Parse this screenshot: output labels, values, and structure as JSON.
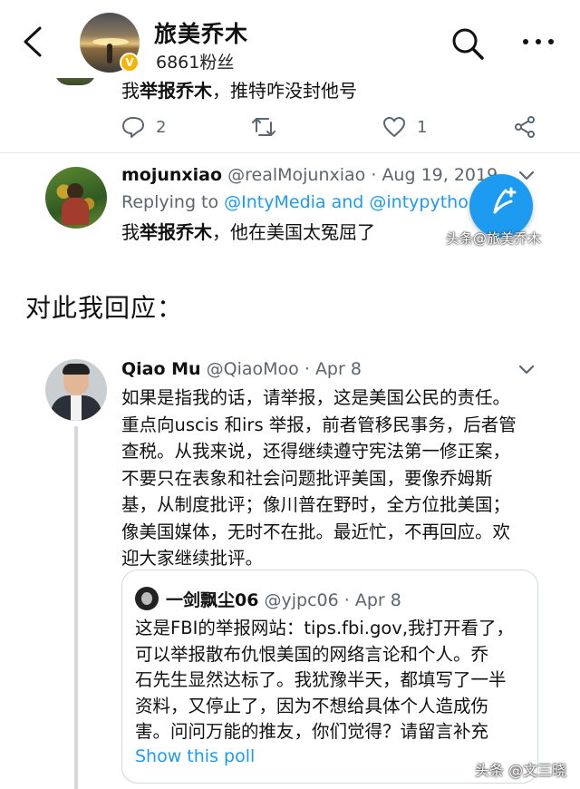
{
  "topbar": {
    "title": "旅美乔木",
    "fans": "6861粉丝"
  },
  "tweet1": {
    "text_pre": "我",
    "text_bold": "举报乔木",
    "text_post": "，推特咋没封他号",
    "reply_count": "2",
    "like_count": "1"
  },
  "tweet2": {
    "name": "mojunxiao",
    "handle": "@realMojunxiao",
    "date": "Aug 19, 2019",
    "replying_prefix": "Replying to ",
    "replying_targets": "@IntyMedia and @intypython",
    "text_pre": "我",
    "text_bold": "举报乔木",
    "text_post": "，他在美国太冤屈了"
  },
  "watermarks": {
    "fab": "头条@旅美乔木",
    "bottom": "头条 @文三晓"
  },
  "intro": "对此我回应：",
  "tweet3": {
    "name": "Qiao Mu",
    "handle": "@QiaoMoo",
    "date": "Apr 8",
    "lines": [
      "如果是指我的话，请举报，这是美国公民的责任。",
      "重点向uscis 和irs 举报，前者管移民事务，后者管",
      "查税。从我来说，还得继续遵守宪法第一修正案，",
      "不要只在表象和社会问题批评美国，要像乔姆斯",
      "基，从制度批评；像川普在野时，全方位批美国；",
      "像美国媒体，无时不在批。最近忙，不再回应。欢",
      "迎大家继续批评。"
    ]
  },
  "quote": {
    "name": "一剑飘尘06",
    "handle": "@yjpc06",
    "date": "Apr 8",
    "lines": [
      "这是FBI的举报网站：tips.fbi.gov,我打开看了，",
      "可以举报散布仇恨美国的网络言论和个人。乔",
      "石先生显然达标了。我犹豫半天，都填写了一半",
      "资料，又停止了，因为不想给具体个人造成伤",
      "害。问问万能的推友，你们觉得？请留言补充"
    ],
    "poll_link": "Show this poll"
  },
  "colors": {
    "accent": "#1d9bf0",
    "muted": "#5b6670",
    "divider": "#e3e6e8"
  },
  "icons": [
    "back-arrow-icon",
    "search-icon",
    "more-icon",
    "reply-icon",
    "retweet-icon",
    "like-icon",
    "share-icon",
    "chevron-down-icon",
    "compose-icon",
    "verified-icon"
  ]
}
